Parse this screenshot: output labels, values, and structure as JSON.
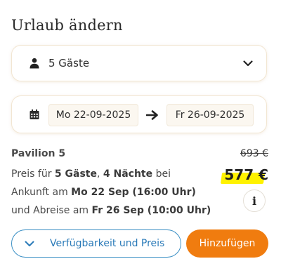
{
  "panel": {
    "title": "Urlaub ändern"
  },
  "guests": {
    "label": "5 Gäste",
    "icon": "person-icon",
    "dropdown_icon": "chevron-down-icon"
  },
  "dates": {
    "calendar_icon": "calendar-icon",
    "from": "Mo 22-09-2025",
    "arrow_icon": "arrow-right-icon",
    "to": "Fr 26-09-2025"
  },
  "offer": {
    "room_name": "Pavilion 5",
    "old_price": "693 €",
    "new_price": "577 €",
    "highlight_color": "#fff200",
    "desc": {
      "preis_fuer": "Preis für ",
      "guests": "5 Gäste",
      "comma": ", ",
      "nights": "4 Nächte",
      "bei": " bei",
      "ankunft_am": "Ankunft am ",
      "arrival": "Mo 22 Sep (16:00 Uhr)",
      "abreise_am": "und Abreise am ",
      "departure": "Fr 26 Sep (10:00 Uhr)"
    },
    "info_label": "i"
  },
  "actions": {
    "availability_label": "Verfügbarkeit und Preis",
    "availability_icon": "chevron-down-icon",
    "availability_color": "#2a7ab8",
    "add_label": "Hinzufügen",
    "add_color": "#f07c0f"
  }
}
